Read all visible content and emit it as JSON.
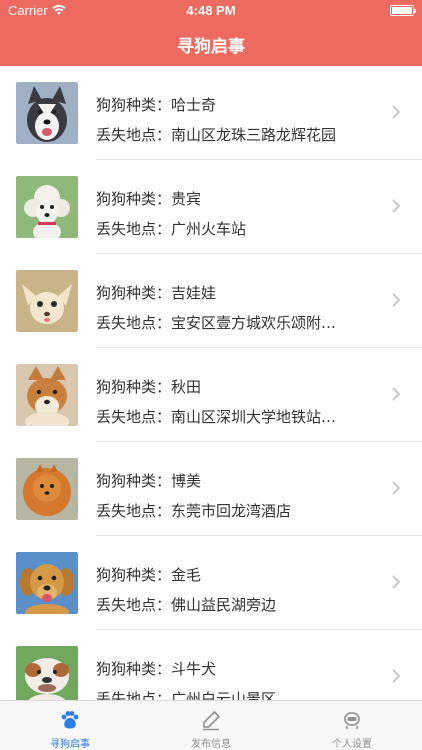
{
  "status_bar": {
    "carrier": "Carrier",
    "time": "4:48 PM"
  },
  "nav": {
    "title": "寻狗启事"
  },
  "list": {
    "items": [
      {
        "breed": "狗狗种类：哈士奇",
        "location": "丢失地点：南山区龙珠三路龙辉花园",
        "photo": "husky"
      },
      {
        "breed": "狗狗种类：贵宾",
        "location": "丢失地点：广州火车站",
        "photo": "poodle"
      },
      {
        "breed": "狗狗种类：吉娃娃",
        "location": "丢失地点：宝安区壹方城欢乐颂附…",
        "photo": "chihuahua"
      },
      {
        "breed": "狗狗种类：秋田",
        "location": "丢失地点：南山区深圳大学地铁站…",
        "photo": "akita"
      },
      {
        "breed": "狗狗种类：博美",
        "location": "丢失地点：东莞市回龙湾酒店",
        "photo": "pomeranian"
      },
      {
        "breed": "狗狗种类：金毛",
        "location": "丢失地点：佛山益民湖旁边",
        "photo": "golden-retriever"
      },
      {
        "breed": "狗狗种类：斗牛犬",
        "location": "丢失地点：广州白云山景区",
        "photo": "bulldog"
      }
    ]
  },
  "tabbar": {
    "tabs": [
      {
        "label": "寻狗启事",
        "icon": "paw-icon",
        "active": true
      },
      {
        "label": "发布信息",
        "icon": "edit-icon",
        "active": false
      },
      {
        "label": "个人设置",
        "icon": "robot-icon",
        "active": false
      }
    ]
  },
  "colors": {
    "accent": "#ec6a5f",
    "tab_active": "#2b7ce9",
    "tab_inactive": "#8e8e8e"
  }
}
